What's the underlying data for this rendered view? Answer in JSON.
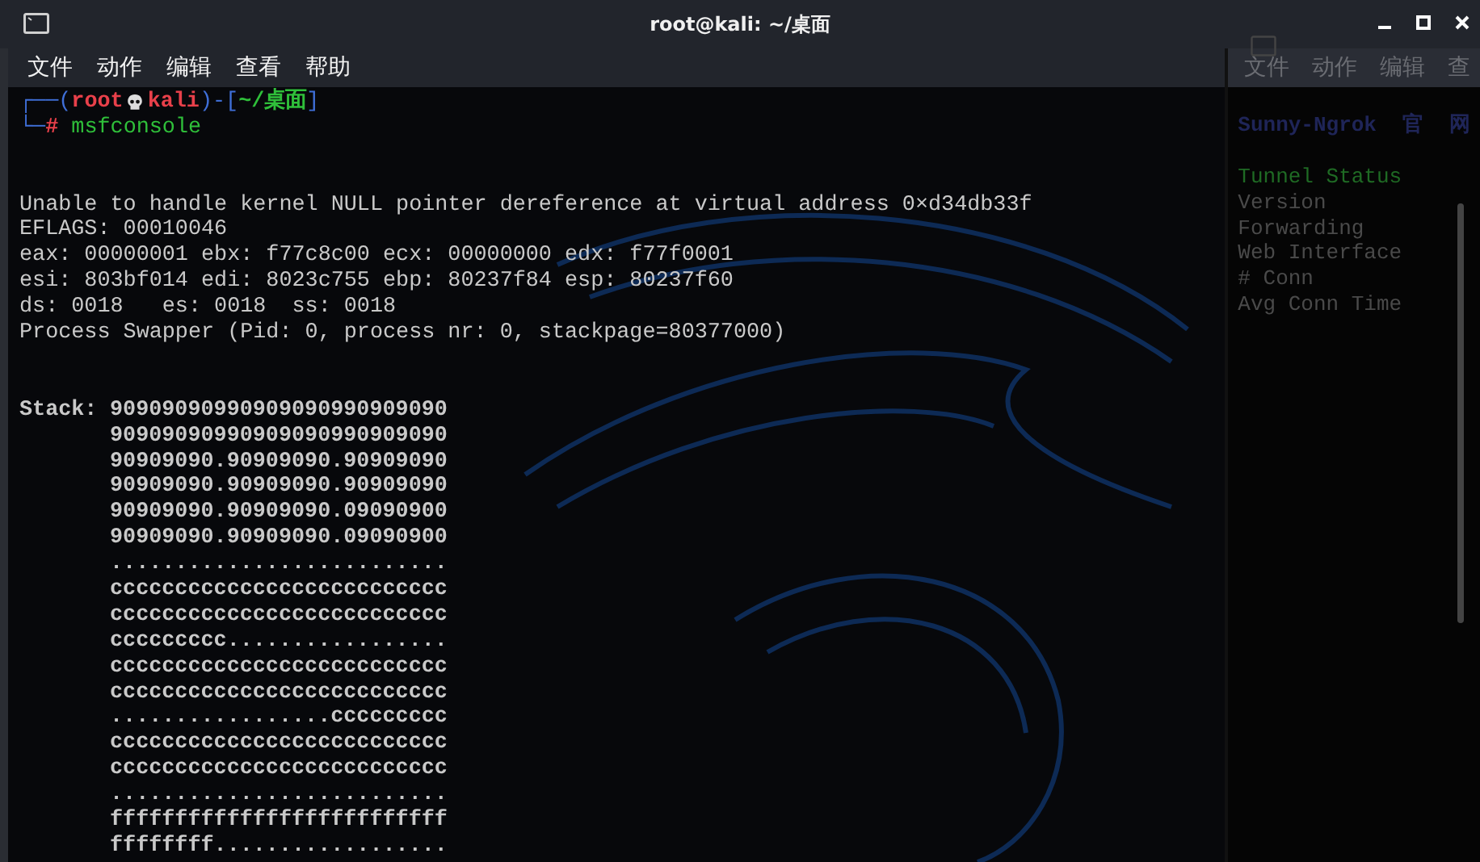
{
  "window": {
    "title": "root@kali: ~/桌面"
  },
  "menu": [
    "文件",
    "动作",
    "编辑",
    "查看",
    "帮助"
  ],
  "prompt": {
    "frame_open": "┌──(",
    "user": "root",
    "host": "kali",
    "separator": ")-[",
    "path": "~/桌面",
    "frame_close": "]",
    "corner": "└─",
    "symbol": "#",
    "command": "msfconsole"
  },
  "output": [
    "Unable to handle kernel NULL pointer dereference at virtual address 0×d34db33f",
    "EFLAGS: 00010046",
    "eax: 00000001 ebx: f77c8c00 ecx: 00000000 edx: f77f0001",
    "esi: 803bf014 edi: 8023c755 ebp: 80237f84 esp: 80237f60",
    "ds: 0018   es: 0018  ss: 0018",
    "Process Swapper (Pid: 0, process nr: 0, stackpage=80377000)"
  ],
  "stack": {
    "label": "Stack:",
    "lines": [
      "90909090990909090990909090",
      "90909090990909090990909090",
      "90909090.90909090.90909090",
      "90909090.90909090.90909090",
      "90909090.90909090.09090900",
      "90909090.90909090.09090900",
      "..........................",
      "cccccccccccccccccccccccccc",
      "cccccccccccccccccccccccccc",
      "ccccccccc.................",
      "cccccccccccccccccccccccccc",
      "cccccccccccccccccccccccccc",
      ".................ccccccccc",
      "cccccccccccccccccccccccccc",
      "cccccccccccccccccccccccccc",
      "..........................",
      "ffffffffffffffffffffffffff",
      "ffffffff.................."
    ]
  },
  "back_window": {
    "menu": [
      "文件",
      "动作",
      "编辑",
      "查"
    ],
    "header": [
      "Sunny-Ngrok",
      "官",
      "网"
    ],
    "lines": [
      {
        "text": "Tunnel Status",
        "kind": "heading"
      },
      {
        "text": "Version",
        "kind": "field"
      },
      {
        "text": "Forwarding",
        "kind": "field"
      },
      {
        "text": "Web Interface",
        "kind": "field"
      },
      {
        "text": "# Conn",
        "kind": "field"
      },
      {
        "text": "Avg Conn Time",
        "kind": "field"
      }
    ]
  }
}
